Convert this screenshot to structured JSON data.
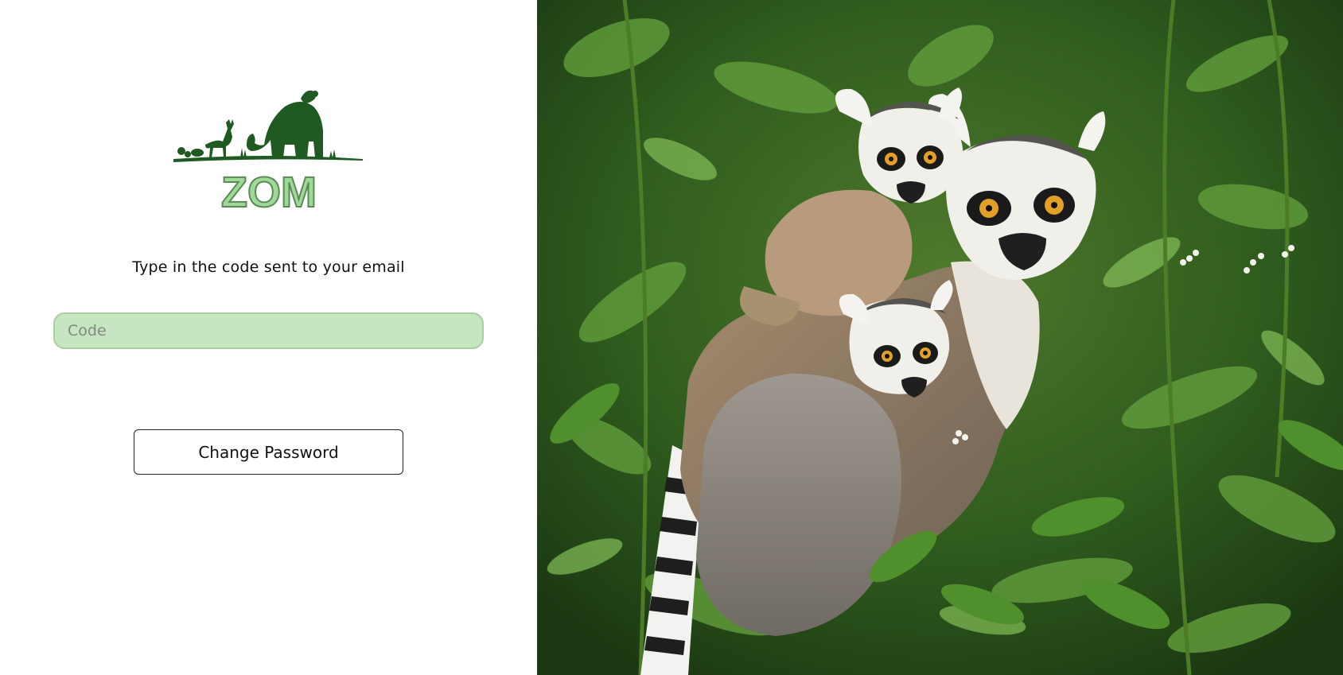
{
  "logo": {
    "text": "ZOM",
    "brand_dark": "#1f5a22",
    "brand_light": "#9ed99a"
  },
  "form": {
    "prompt": "Type in the code sent to your email",
    "code_placeholder": "Code",
    "code_value": "",
    "submit_label": "Change Password"
  },
  "colors": {
    "input_bg": "#c6e6c1",
    "input_border": "#a7cfa0"
  },
  "hero": {
    "icon": "lemur-photo"
  }
}
